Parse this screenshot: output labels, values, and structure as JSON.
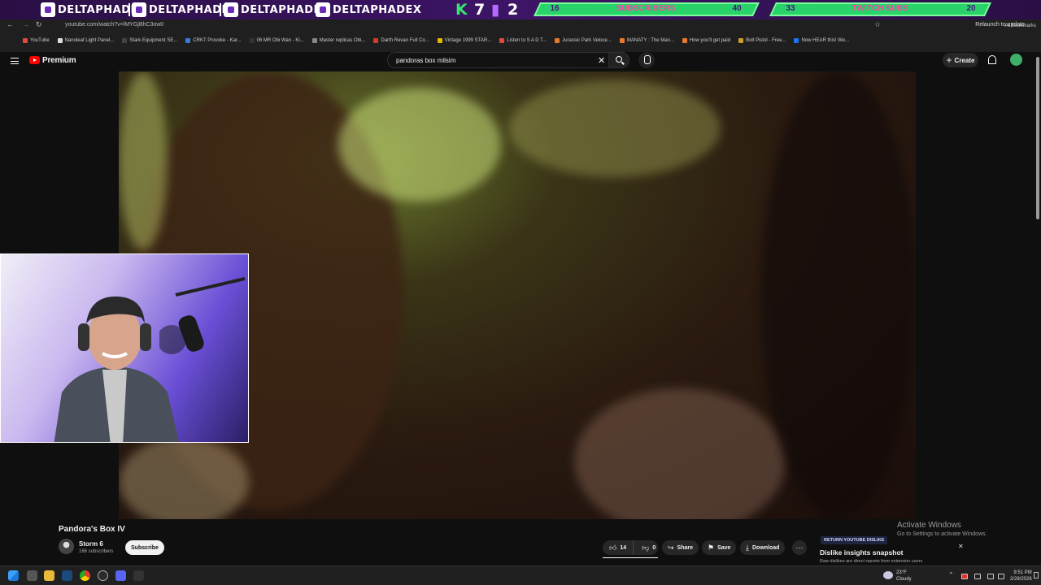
{
  "stream_overlay": {
    "socials": [
      {
        "name": "DELTAPHADE",
        "icon": "twitch-icon"
      },
      {
        "name": "DELTAPHADE",
        "icon": "instagram-icon"
      },
      {
        "name": "DELTAPHADE",
        "icon": "youtube-icon"
      },
      {
        "name": "DELTAPHADEX",
        "icon": "twitter-icon"
      }
    ],
    "kick_count": "7",
    "twitch_count": "2",
    "sub_goal": {
      "current": "16",
      "label": "SUBSCRIBERS",
      "target": "40"
    },
    "twitch_goal": {
      "current": "33",
      "label": "TWITCH SUBS",
      "target": "20"
    }
  },
  "browser": {
    "url": "youtube.com/watch?v=lMYGjBhC3ow0",
    "relaunch": "Relaunch to update",
    "bookmarks": [
      "YouTube",
      "Nanoleaf Light Panel...",
      "Stark Equipment SE...",
      "CRKT Provoke - Kar...",
      "06 MR Obi Wan - Ki...",
      "Master replicas Obi...",
      "Darth Revan Full Co...",
      "Vintage 1999 STAR...",
      "Listen to S A D T...",
      "Jurassic Park Veloce...",
      "MANATY : The Man...",
      "How you'll get paid",
      "Bolt Pistol - Free...",
      "Now HEAR this! We..."
    ],
    "all_bookmarks": "All Bookmarks"
  },
  "youtube": {
    "logo": "Premium",
    "search_value": "pandoras box milsim",
    "create_label": "Create"
  },
  "video": {
    "title": "Pandora's Box IV",
    "channel": "Storm 6",
    "subscribers": "166 subscribers",
    "subscribe_label": "Subscribe",
    "likes": "14",
    "dislikes": "0",
    "share_label": "Share",
    "save_label": "Save",
    "download_label": "Download"
  },
  "dislike_ext": {
    "badge": "RETURN YOUTUBE DISLIKE",
    "title": "Dislike insights snapshot",
    "body": "Raw dislikes are direct reports from extension users"
  },
  "activate_windows": {
    "line1": "Activate Windows",
    "line2": "Go to Settings to activate Windows."
  },
  "taskbar": {
    "weather_temp": "23°F",
    "weather_desc": "Cloudy",
    "time": "9:51 PM",
    "date": "2/28/2026"
  }
}
